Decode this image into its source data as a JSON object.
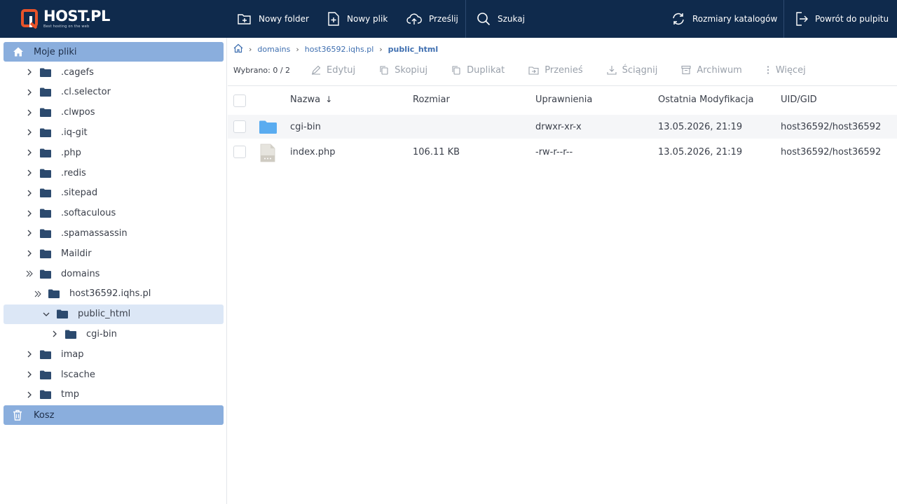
{
  "brand": {
    "name": "HOST.PL",
    "tagline": "Best hosting on the web"
  },
  "toolbar": {
    "new_folder": "Nowy folder",
    "new_file": "Nowy plik",
    "upload": "Prześlij",
    "search": "Szukaj",
    "folder_sizes": "Rozmiary katalogów",
    "back": "Powrót do pulpitu"
  },
  "sidebar": {
    "root_label": "Moje pliki",
    "trash_label": "Kosz",
    "items": [
      {
        "label": ".cagefs"
      },
      {
        "label": ".cl.selector"
      },
      {
        "label": ".clwpos"
      },
      {
        "label": ".iq-git"
      },
      {
        "label": ".php"
      },
      {
        "label": ".redis"
      },
      {
        "label": ".sitepad"
      },
      {
        "label": ".softaculous"
      },
      {
        "label": ".spamassassin"
      },
      {
        "label": "Maildir"
      },
      {
        "label": "domains"
      },
      {
        "label": "host36592.iqhs.pl"
      },
      {
        "label": "public_html"
      },
      {
        "label": "cgi-bin"
      },
      {
        "label": "imap"
      },
      {
        "label": "lscache"
      },
      {
        "label": "tmp"
      }
    ]
  },
  "breadcrumb": {
    "items": [
      "domains",
      "host36592.iqhs.pl"
    ],
    "current": "public_html"
  },
  "actions": {
    "selected": "Wybrano: 0 / 2",
    "edit": "Edytuj",
    "copy": "Skopiuj",
    "duplicate": "Duplikat",
    "move": "Przenieś",
    "download": "Ściągnij",
    "archive": "Archiwum",
    "more": "Więcej"
  },
  "table": {
    "columns": [
      "Nazwa",
      "Rozmiar",
      "Uprawnienia",
      "Ostatnia Modyfikacja",
      "UID/GID"
    ],
    "sort_indicator": "↓",
    "rows": [
      {
        "name": "cgi-bin",
        "type": "folder",
        "size": "",
        "perms": "drwxr-xr-x",
        "modified": "13.05.2026, 21:19",
        "owner": "host36592/host36592"
      },
      {
        "name": "index.php",
        "type": "file",
        "size": "106.11 KB",
        "perms": "-rw-r--r--",
        "modified": "13.05.2026, 21:19",
        "owner": "host36592/host36592"
      }
    ]
  },
  "colors": {
    "topbar": "#0f2a4c",
    "sidebar_head": "#8aaedd",
    "selected_row": "#dce7f6",
    "folder": "#2c4a6e",
    "folder_light": "#5aacf0",
    "accent": "#3f6fb0",
    "logo_orange": "#e8532a"
  }
}
